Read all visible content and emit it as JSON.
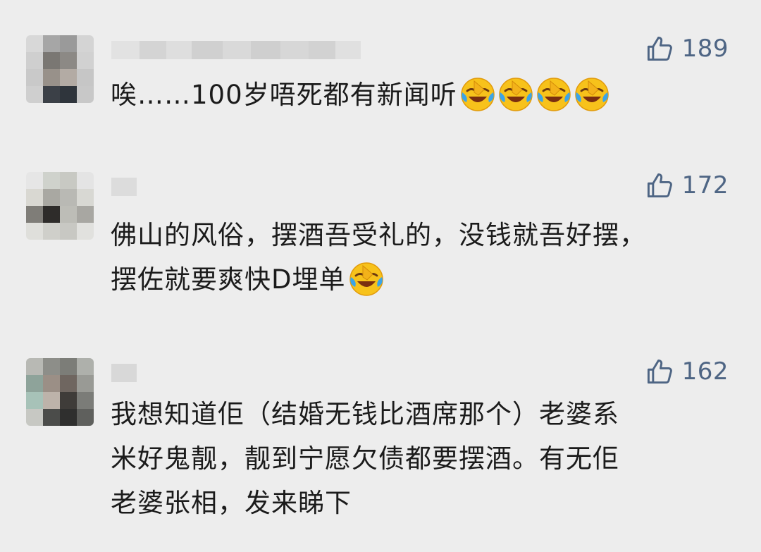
{
  "comments": [
    {
      "username": "",
      "likes": "189",
      "lines": [
        "唉……100岁唔死都有新闻听"
      ],
      "emoji_counts": [
        4
      ]
    },
    {
      "username": "",
      "likes": "172",
      "lines": [
        "佛山的风俗，摆酒吾受礼的，没钱就吾好摆，",
        "摆佐就要爽快D埋单"
      ],
      "emoji_counts": [
        0,
        1
      ]
    },
    {
      "username": "",
      "likes": "162",
      "lines": [
        "我想知道佢（结婚无钱比酒席那个）老婆系",
        "米好鬼靓，靓到宁愿欠债都要摆酒。有无佢",
        "老婆张相，发来睇下"
      ],
      "emoji_counts": [
        0,
        0,
        0
      ]
    }
  ],
  "icons": {
    "like": "thumbs-up-outline-icon",
    "emoji": "face-with-tears-of-joy-icon"
  },
  "colors": {
    "background": "#ededed",
    "text": "#1b1b1b",
    "like": "#4e6584",
    "emoji": "#f7c21b"
  }
}
